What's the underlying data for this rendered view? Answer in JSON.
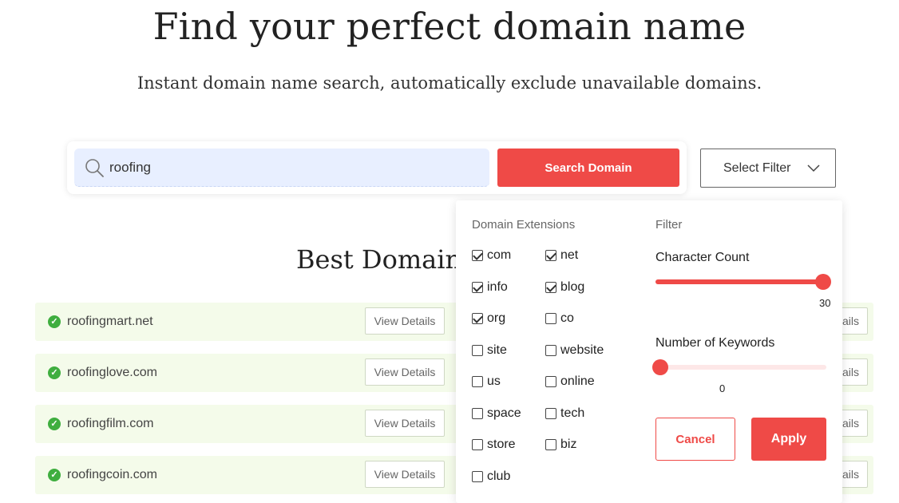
{
  "hero": {
    "title": "Find your perfect domain name",
    "subtitle": "Instant domain name search, automatically exclude unavailable domains."
  },
  "search": {
    "value": "roofing",
    "icon": "search-icon",
    "button_label": "Search Domain"
  },
  "filter_select": {
    "label": "Select Filter",
    "icon": "chevron-down-icon"
  },
  "results": {
    "title": "Best Domain",
    "details_label": "View Details",
    "details_label_partial": "ails",
    "items": [
      {
        "domain": "roofingmart.net",
        "available": true
      },
      {
        "domain": "roofinglove.com",
        "available": true
      },
      {
        "domain": "roofingfilm.com",
        "available": true
      },
      {
        "domain": "roofingcoin.com",
        "available": true
      }
    ]
  },
  "filter_panel": {
    "extensions_heading": "Domain Extensions",
    "filter_heading": "Filter",
    "extensions": [
      {
        "label": "com",
        "checked": true
      },
      {
        "label": "net",
        "checked": true
      },
      {
        "label": "info",
        "checked": true
      },
      {
        "label": "blog",
        "checked": true
      },
      {
        "label": "org",
        "checked": true
      },
      {
        "label": "co",
        "checked": false
      },
      {
        "label": "site",
        "checked": false
      },
      {
        "label": "website",
        "checked": false
      },
      {
        "label": "us",
        "checked": false
      },
      {
        "label": "online",
        "checked": false
      },
      {
        "label": "space",
        "checked": false
      },
      {
        "label": "tech",
        "checked": false
      },
      {
        "label": "store",
        "checked": false
      },
      {
        "label": "biz",
        "checked": false
      },
      {
        "label": "club",
        "checked": false
      }
    ],
    "character_count": {
      "label": "Character Count",
      "value": "30",
      "fraction": 1.0
    },
    "keywords": {
      "label": "Number of Keywords",
      "value": "0",
      "fraction": 0.0
    },
    "cancel_label": "Cancel",
    "apply_label": "Apply"
  },
  "colors": {
    "accent": "#ef4a47",
    "search_bg": "#e8efff",
    "row_bg": "#f4fbea",
    "available_green": "#3fae3f"
  }
}
